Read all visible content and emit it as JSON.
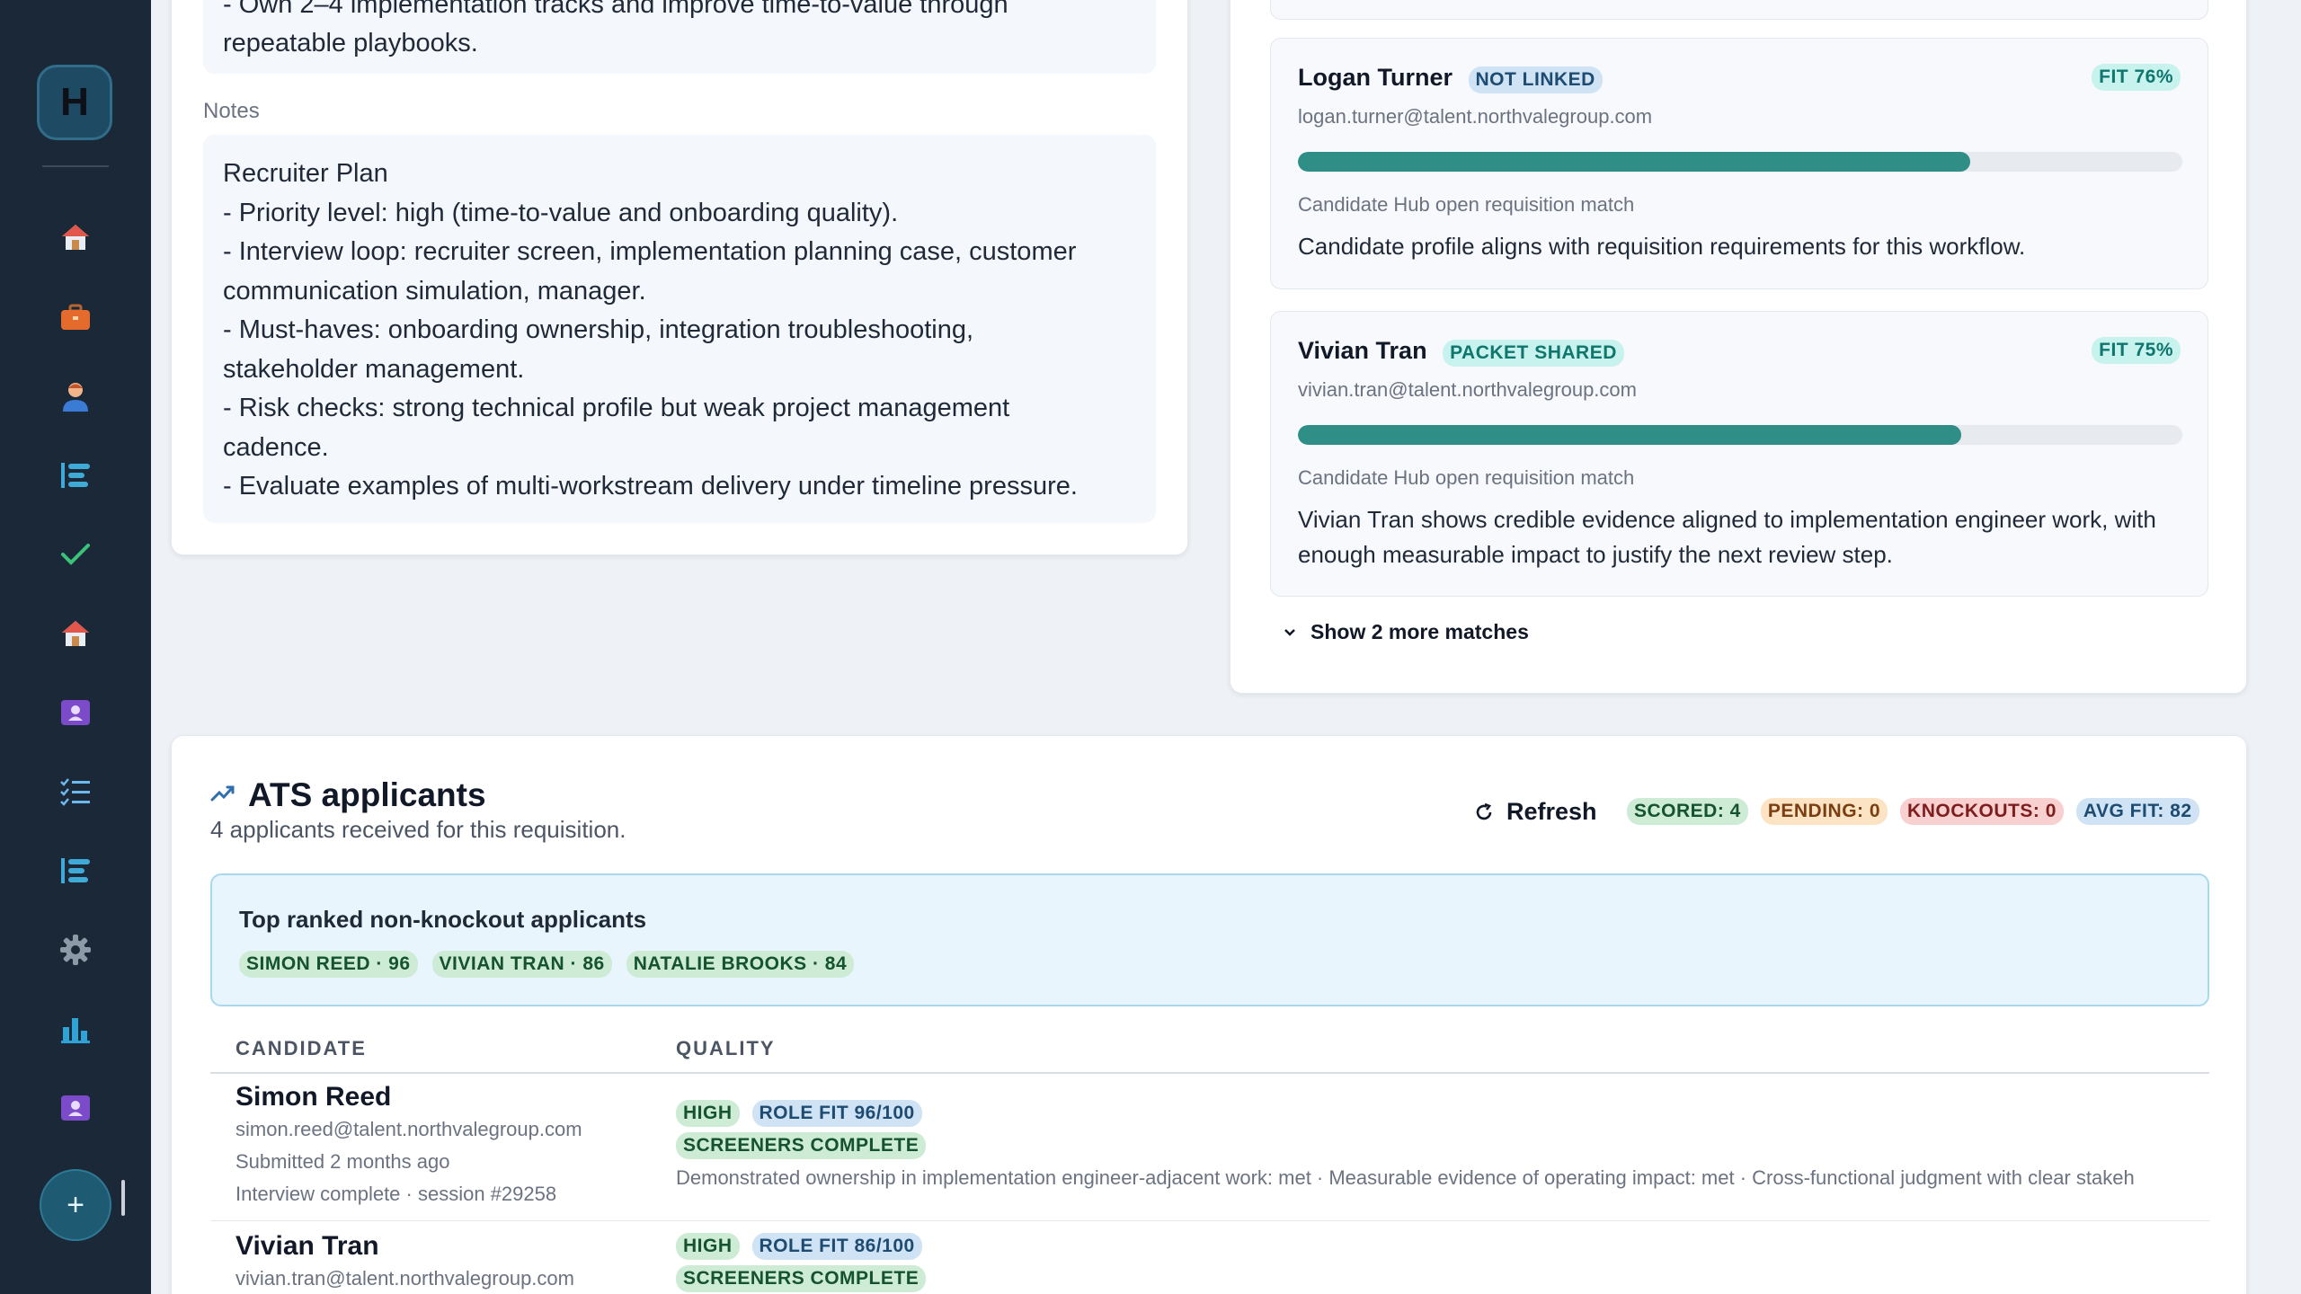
{
  "sidebar": {
    "logo": "H",
    "items": [
      "home-icon",
      "briefcase-icon",
      "person-icon",
      "list-icon",
      "check-icon",
      "home-icon",
      "contact-card-icon",
      "checklist-icon",
      "list-icon",
      "gear-icon",
      "bar-chart-icon",
      "contact-card-icon"
    ],
    "fab": "+"
  },
  "requisition": {
    "top_lines": [
      "- Own 2–4 implementation tracks and improve time-to-value through",
      "repeatable playbooks."
    ],
    "notes_label": "Notes",
    "notes_lines": [
      "Recruiter Plan",
      "- Priority level: high (time-to-value and onboarding quality).",
      "- Interview loop: recruiter screen, implementation planning case, customer",
      "communication simulation, manager.",
      "- Must-haves: onboarding ownership, integration troubleshooting,",
      "stakeholder management.",
      "- Risk checks: strong technical profile but weak project management",
      "cadence.",
      "- Evaluate examples of multi-workstream delivery under timeline pressure."
    ]
  },
  "matches": [
    {
      "name": "Logan Turner",
      "status": "NOT LINKED",
      "fit": "FIT 76%",
      "fit_value": 76,
      "email": "logan.turner@talent.northvalegroup.com",
      "source": "Candidate Hub open requisition match",
      "description": "Candidate profile aligns with requisition requirements for this workflow."
    },
    {
      "name": "Vivian Tran",
      "status": "PACKET SHARED",
      "fit": "FIT 75%",
      "fit_value": 75,
      "email": "vivian.tran@talent.northvalegroup.com",
      "source": "Candidate Hub open requisition match",
      "description": "Vivian Tran shows credible evidence aligned to implementation engineer work, with enough measurable impact to justify the next review step."
    }
  ],
  "show_more": "Show 2 more matches",
  "ats": {
    "title": "ATS applicants",
    "subtitle": "4 applicants received for this requisition.",
    "refresh": "Refresh",
    "stats": {
      "scored": "SCORED: 4",
      "pending": "PENDING: 0",
      "knockouts": "KNOCKOUTS: 0",
      "avg_fit": "AVG FIT: 82"
    },
    "top_ranked_title": "Top ranked non-knockout applicants",
    "top_ranked": [
      "SIMON REED · 96",
      "VIVIAN TRAN · 86",
      "NATALIE BROOKS · 84"
    ],
    "columns": [
      "CANDIDATE",
      "QUALITY"
    ],
    "rows": [
      {
        "name": "Simon Reed",
        "email": "simon.reed@talent.northvalegroup.com",
        "submitted": "Submitted 2 months ago",
        "interview": "Interview complete · session #29258",
        "level": "HIGH",
        "role_fit": "ROLE FIT 96/100",
        "screeners": "SCREENERS COMPLETE",
        "evidence": "Demonstrated ownership in implementation engineer-adjacent work: met · Measurable evidence of operating impact: met · Cross-functional judgment with clear stakeh"
      },
      {
        "name": "Vivian Tran",
        "email": "vivian.tran@talent.northvalegroup.com",
        "level": "HIGH",
        "role_fit": "ROLE FIT 86/100",
        "screeners": "SCREENERS COMPLETE"
      }
    ]
  }
}
